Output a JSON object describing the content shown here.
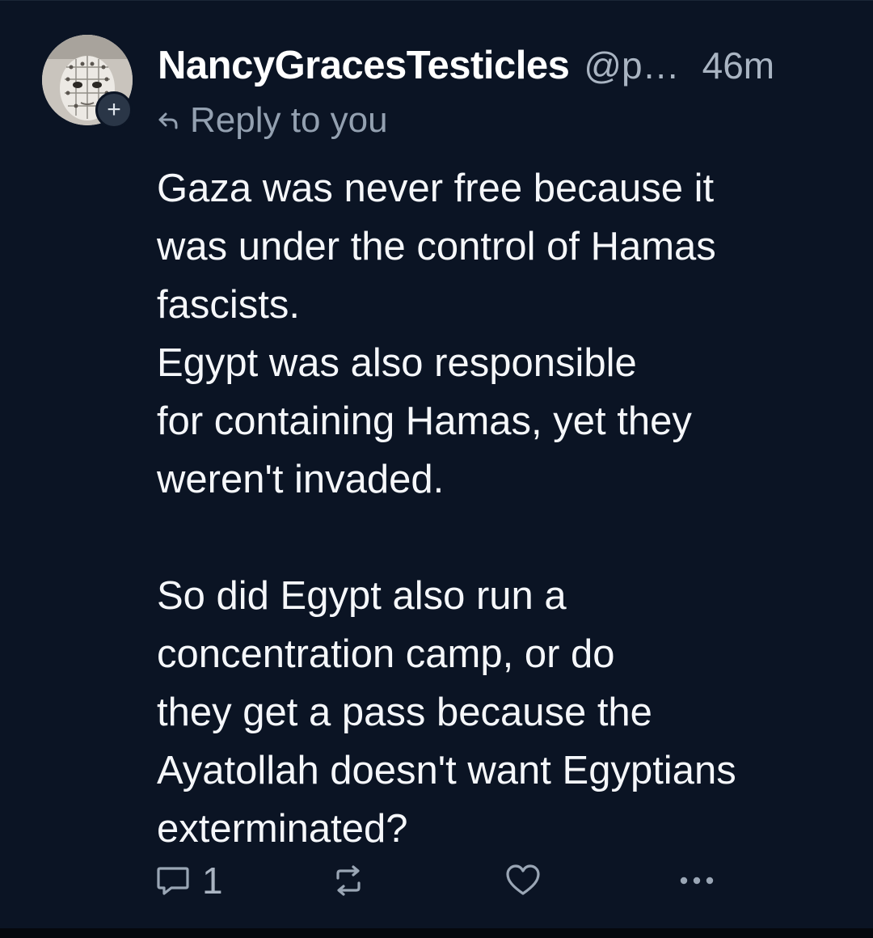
{
  "post": {
    "author": {
      "display_name": "NancyGracesTesticles",
      "handle": "@p…",
      "avatar": "avatar-image",
      "follow_badge": "+"
    },
    "time": "46m",
    "reply_label": "Reply to you",
    "body_paragraphs": [
      [
        "Gaza was never free because it",
        "was under the control of Hamas",
        "fascists.",
        "Egypt was also responsible",
        "for containing Hamas, yet they",
        "weren't invaded."
      ],
      [
        "So did Egypt also run a",
        "concentration camp, or do",
        "they get a pass because the",
        "Ayatollah doesn't want Egyptians",
        "exterminated?"
      ]
    ],
    "actions": {
      "reply_icon": "comment-icon",
      "reply_count": "1",
      "repost_icon": "repost-icon",
      "like_icon": "heart-icon",
      "more_icon": "more-icon"
    }
  },
  "colors": {
    "background": "#0b1424",
    "text": "#f5f7fa",
    "muted": "#a9b4c2"
  }
}
